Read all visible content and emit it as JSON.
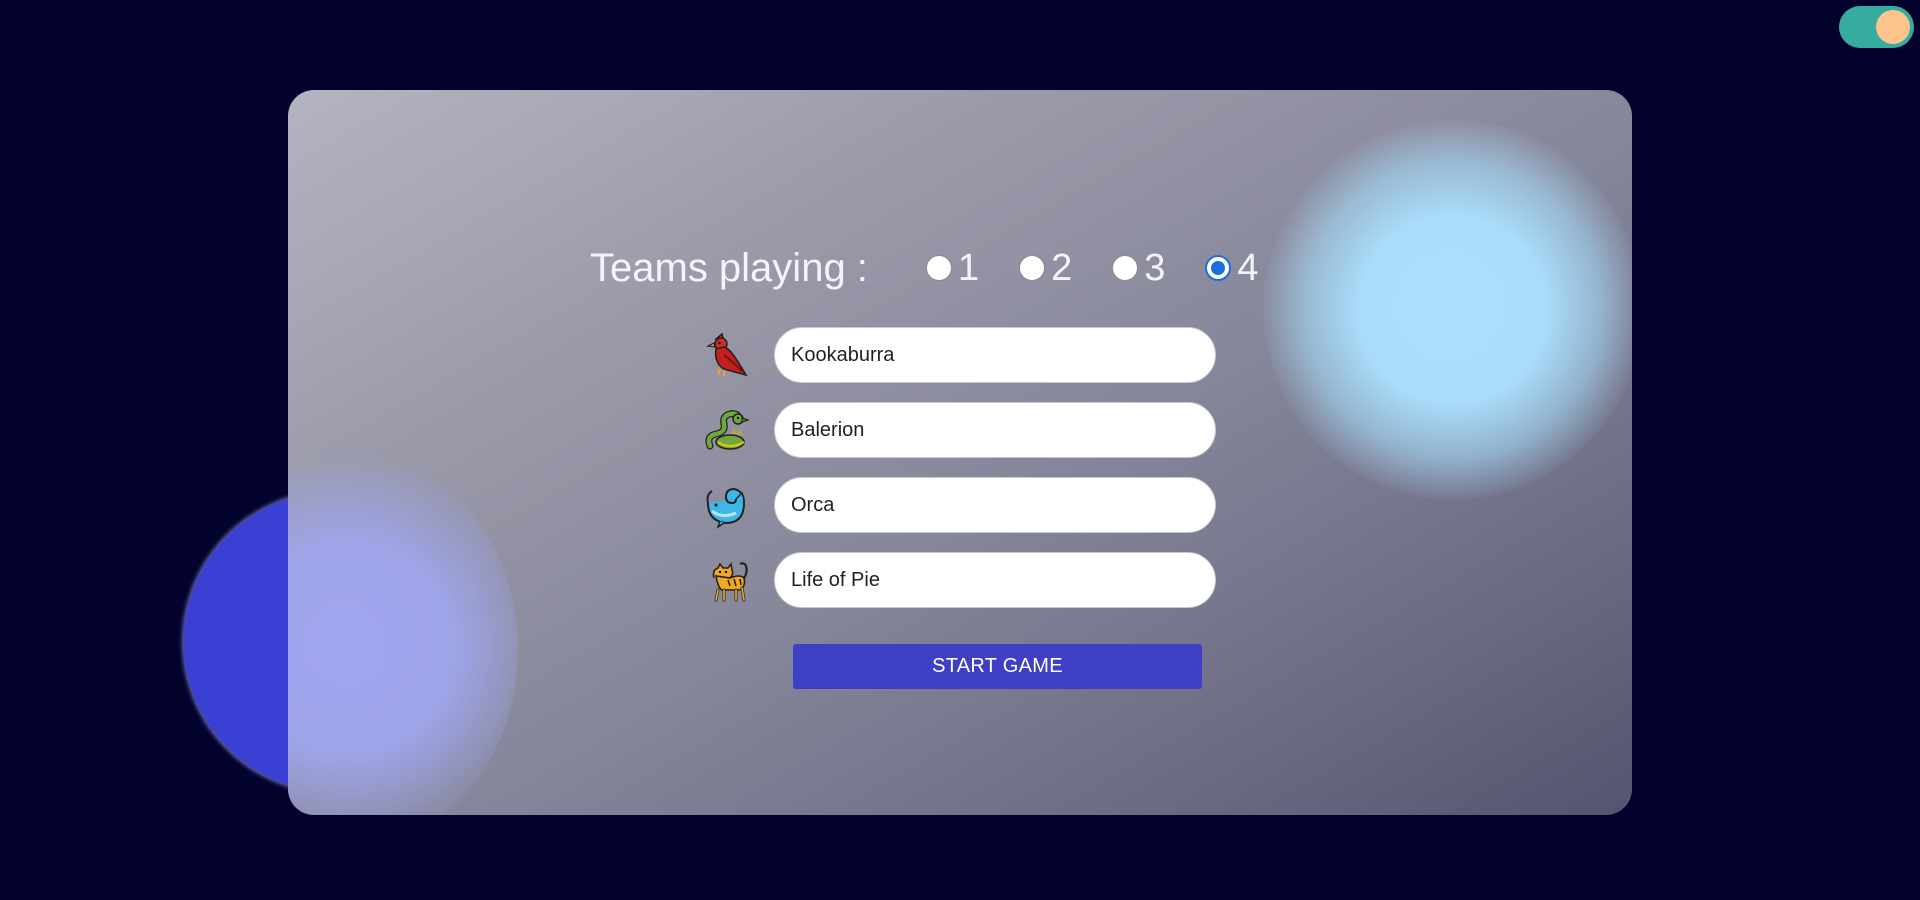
{
  "teams_section": {
    "label": "Teams playing :",
    "options": [
      {
        "label": "1",
        "checked": false
      },
      {
        "label": "2",
        "checked": false
      },
      {
        "label": "3",
        "checked": false
      },
      {
        "label": "4",
        "checked": true
      }
    ]
  },
  "teams": [
    {
      "name": "Kookaburra",
      "icon": "cardinal-bird-icon"
    },
    {
      "name": "Balerion",
      "icon": "dragon-icon"
    },
    {
      "name": "Orca",
      "icon": "whale-icon"
    },
    {
      "name": "Life of Pie",
      "icon": "tiger-icon"
    }
  ],
  "start_button": {
    "label": "START GAME"
  },
  "colors": {
    "background": "#02022d",
    "accent": "#3e3fc5",
    "toggle_track": "#37aba0",
    "toggle_knob": "#ffc48e",
    "radio_checked": "#1a6fe0"
  },
  "theme_toggle": {
    "state": "on",
    "icon": "theme-toggle-icon"
  }
}
